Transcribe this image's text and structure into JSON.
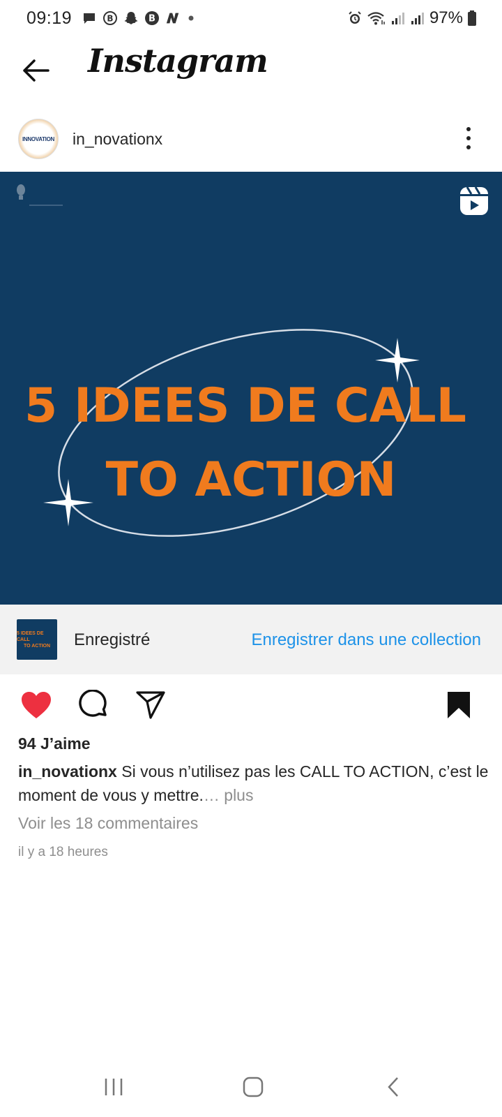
{
  "status_bar": {
    "time": "09:19",
    "battery": "97%",
    "left_icons": [
      "message-icon",
      "b-circle-icon",
      "snapchat-icon",
      "b-badge-icon",
      "n-icon",
      "dot-icon"
    ],
    "right_icons": [
      "alarm-icon",
      "wifi-icon",
      "signal-icon",
      "signal-icon",
      "battery-icon"
    ]
  },
  "header": {
    "app_title": "Instagram",
    "back_icon": "arrow-left-icon"
  },
  "post": {
    "username": "in_novationx",
    "avatar_text": "INNOVATION",
    "media": {
      "line1": "5 IDEES DE CALL",
      "line2": "TO ACTION",
      "background": "#103c62",
      "text_color": "#f07b1e"
    },
    "saved": {
      "thumb_line1": "5 IDEES DE CALL",
      "thumb_line2": "TO ACTION",
      "label": "Enregistré",
      "collection_link": "Enregistrer dans une collection"
    },
    "likes": "94 J’aime",
    "caption_user": "in_novationx",
    "caption_text": " Si vous n’utilisez pas les CALL TO ACTION, c’est le moment de vous y mettre.",
    "caption_more": "… plus",
    "view_comments": "Voir les 18 commentaires",
    "time_ago": "il y a 18 heures"
  },
  "colors": {
    "like": "#ed3040",
    "link": "#1d92e8",
    "muted": "#8e8e8e"
  }
}
